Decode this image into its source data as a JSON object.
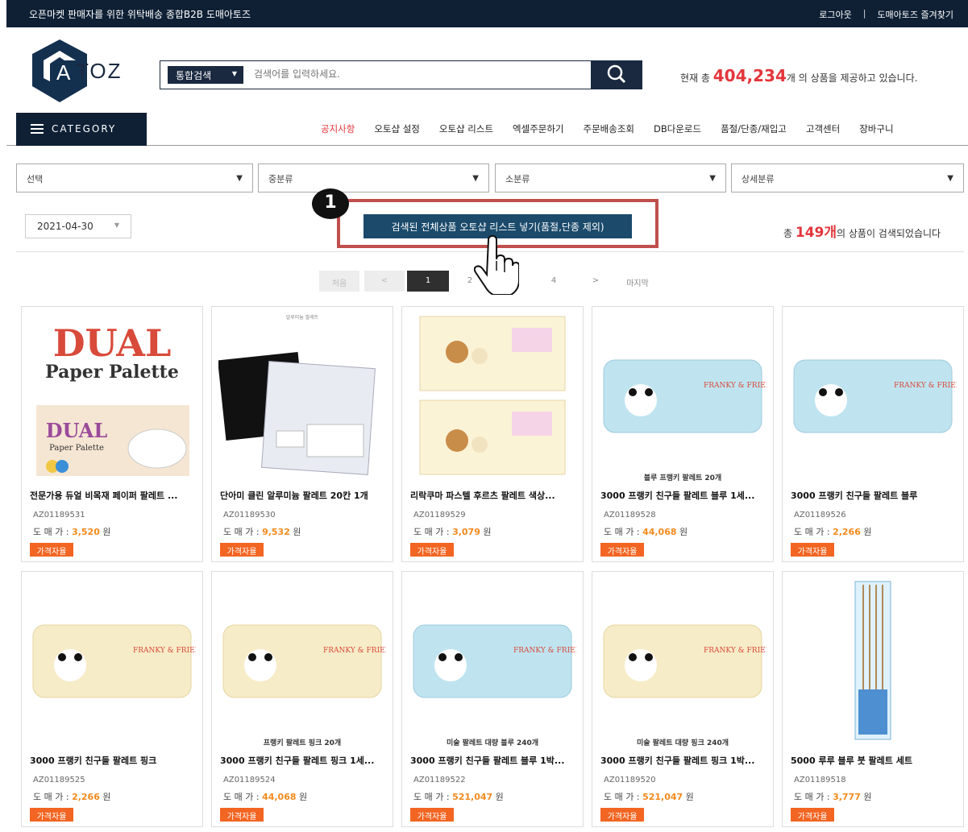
{
  "topbar": {
    "tagline": "오픈마켓 판매자를 위한 위탁배송 종합B2B 도매아토즈",
    "logout": "로그아웃",
    "sep": "|",
    "bookmark": "도매아토즈 즐겨찾기"
  },
  "logo": {
    "text": "ATOZ"
  },
  "search": {
    "select_label": "통합검색",
    "placeholder": "검색어를 입력하세요."
  },
  "stat": {
    "prefix": "현재 총",
    "count": "404,234",
    "suffix": "개 의 상품을 제공하고 있습니다."
  },
  "nav": {
    "category": "CATEGORY",
    "items": [
      "공지사항",
      "오토샵 설정",
      "오토샵 리스트",
      "엑셀주문하기",
      "주문배송조회",
      "DB다운로드",
      "품절/단종/재입고",
      "고객센터",
      "장바구니"
    ]
  },
  "filters": [
    "선택",
    "중분류",
    "소분류",
    "상세분류"
  ],
  "date": "2021-04-30",
  "annotation_badge": "1",
  "bulk_button": "검색된 전체상품 오토샵 리스트 넣기(품절,단종 제외)",
  "result": {
    "prefix": "총",
    "count": "149개",
    "suffix": "의 상품이 검색되었습니다"
  },
  "pager": {
    "first": "처음",
    "prev": "<",
    "pages": [
      "1",
      "2",
      "3",
      "4"
    ],
    "current": "1",
    "next": ">",
    "last": "마지막"
  },
  "colors": {
    "navy": "#0f2035",
    "accent_red": "#e2363c",
    "price_orange": "#f28a1d",
    "tag_orange": "#f26522",
    "highlight": "#c0504d"
  },
  "products": [
    {
      "img_caption": "",
      "brand_lines": [
        "DUAL",
        "Paper Palette"
      ],
      "title": "전문가용 듀얼 비목재 페이퍼 팔레트 ...",
      "code": "AZ01189531",
      "price_label": "도 매 가 :",
      "price": "3,520",
      "unit": "원",
      "tag": "가격자율"
    },
    {
      "img_caption": "",
      "top_caption": "알루미늄 팔레트",
      "title": "단아미 클린 알루미늄 팔레트 20칸 1개",
      "code": "AZ01189530",
      "price_label": "도 매 가 :",
      "price": "9,532",
      "unit": "원",
      "tag": "가격자율"
    },
    {
      "img_caption": "",
      "title": "리락쿠마 파스텔 후르츠 팔레트 색상...",
      "code": "AZ01189529",
      "price_label": "도 매 가 :",
      "price": "3,079",
      "unit": "원",
      "tag": "가격자율"
    },
    {
      "img_caption": "블루 프랭키 팔레트 20개",
      "title": "3000 프랭키 친구들 팔레트 블루 1세...",
      "code": "AZ01189528",
      "price_label": "도 매 가 :",
      "price": "44,068",
      "unit": "원",
      "tag": "가격자율"
    },
    {
      "img_caption": "",
      "title": "3000 프랭키 친구들 팔레트 블루",
      "code": "AZ01189526",
      "price_label": "도 매 가 :",
      "price": "2,266",
      "unit": "원",
      "tag": "가격자율"
    },
    {
      "img_caption": "",
      "title": "3000 프랭키 친구들 팔레트 핑크",
      "code": "AZ01189525",
      "price_label": "도 매 가 :",
      "price": "2,266",
      "unit": "원",
      "tag": "가격자율"
    },
    {
      "img_caption": "프랭키 팔레트 핑크 20개",
      "title": "3000 프랭키 친구들 팔레트 핑크 1세...",
      "code": "AZ01189524",
      "price_label": "도 매 가 :",
      "price": "44,068",
      "unit": "원",
      "tag": "가격자율"
    },
    {
      "img_caption": "미술 팔레트 대량 블루 240개",
      "title": "3000 프랭키 친구들 팔레트 블루 1박...",
      "code": "AZ01189522",
      "price_label": "도 매 가 :",
      "price": "521,047",
      "unit": "원",
      "tag": "가격자율"
    },
    {
      "img_caption": "미술 팔레트 대량 핑크 240개",
      "title": "3000 프랭키 친구들 팔레트 핑크 1박...",
      "code": "AZ01189520",
      "price_label": "도 매 가 :",
      "price": "521,047",
      "unit": "원",
      "tag": "가격자율"
    },
    {
      "img_caption": "",
      "title": "5000 루루 블루 붓 팔레트 세트",
      "code": "AZ01189518",
      "price_label": "도 매 가 :",
      "price": "3,777",
      "unit": "원",
      "tag": "가격자율"
    }
  ]
}
